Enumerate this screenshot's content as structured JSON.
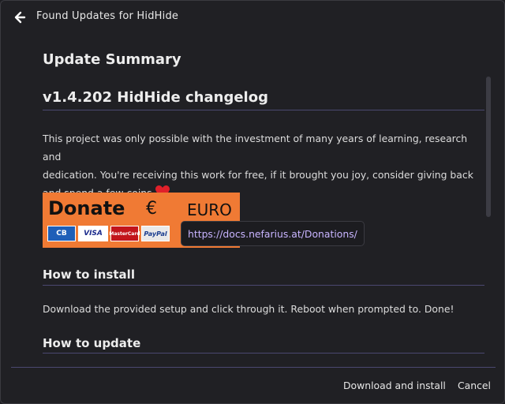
{
  "window": {
    "title": "Found Updates for HidHide"
  },
  "content": {
    "summary_heading": "Update Summary",
    "version_heading": "v1.4.202 HidHide changelog",
    "paragraph_line1": "This project was only possible with the investment of many years of learning, research and",
    "paragraph_line2": "dedication. You're receiving this work for free, if it brought you joy, consider giving back",
    "paragraph_line3": "and spend a few coins",
    "donate": {
      "word": "Donate",
      "euro_sign": "€",
      "euro_word": "EURO",
      "cards": [
        "CB",
        "VISA",
        "MasterCard",
        "PayPal"
      ]
    },
    "tooltip_url": "https://docs.nefarius.at/Donations/",
    "install_heading": "How to install",
    "install_text": "Download the provided setup and click through it. Reboot when prompted to. Done!",
    "update_heading": "How to update"
  },
  "footer": {
    "download_label": "Download and install",
    "cancel_label": "Cancel"
  },
  "colors": {
    "background": "#202024",
    "rule": "#4a4870",
    "donate_orange": "#f07a34",
    "tooltip_text": "#c8b4ff",
    "heart": "#e0202a"
  },
  "icons": {
    "back": "back-arrow-icon",
    "heart": "heart-icon"
  }
}
